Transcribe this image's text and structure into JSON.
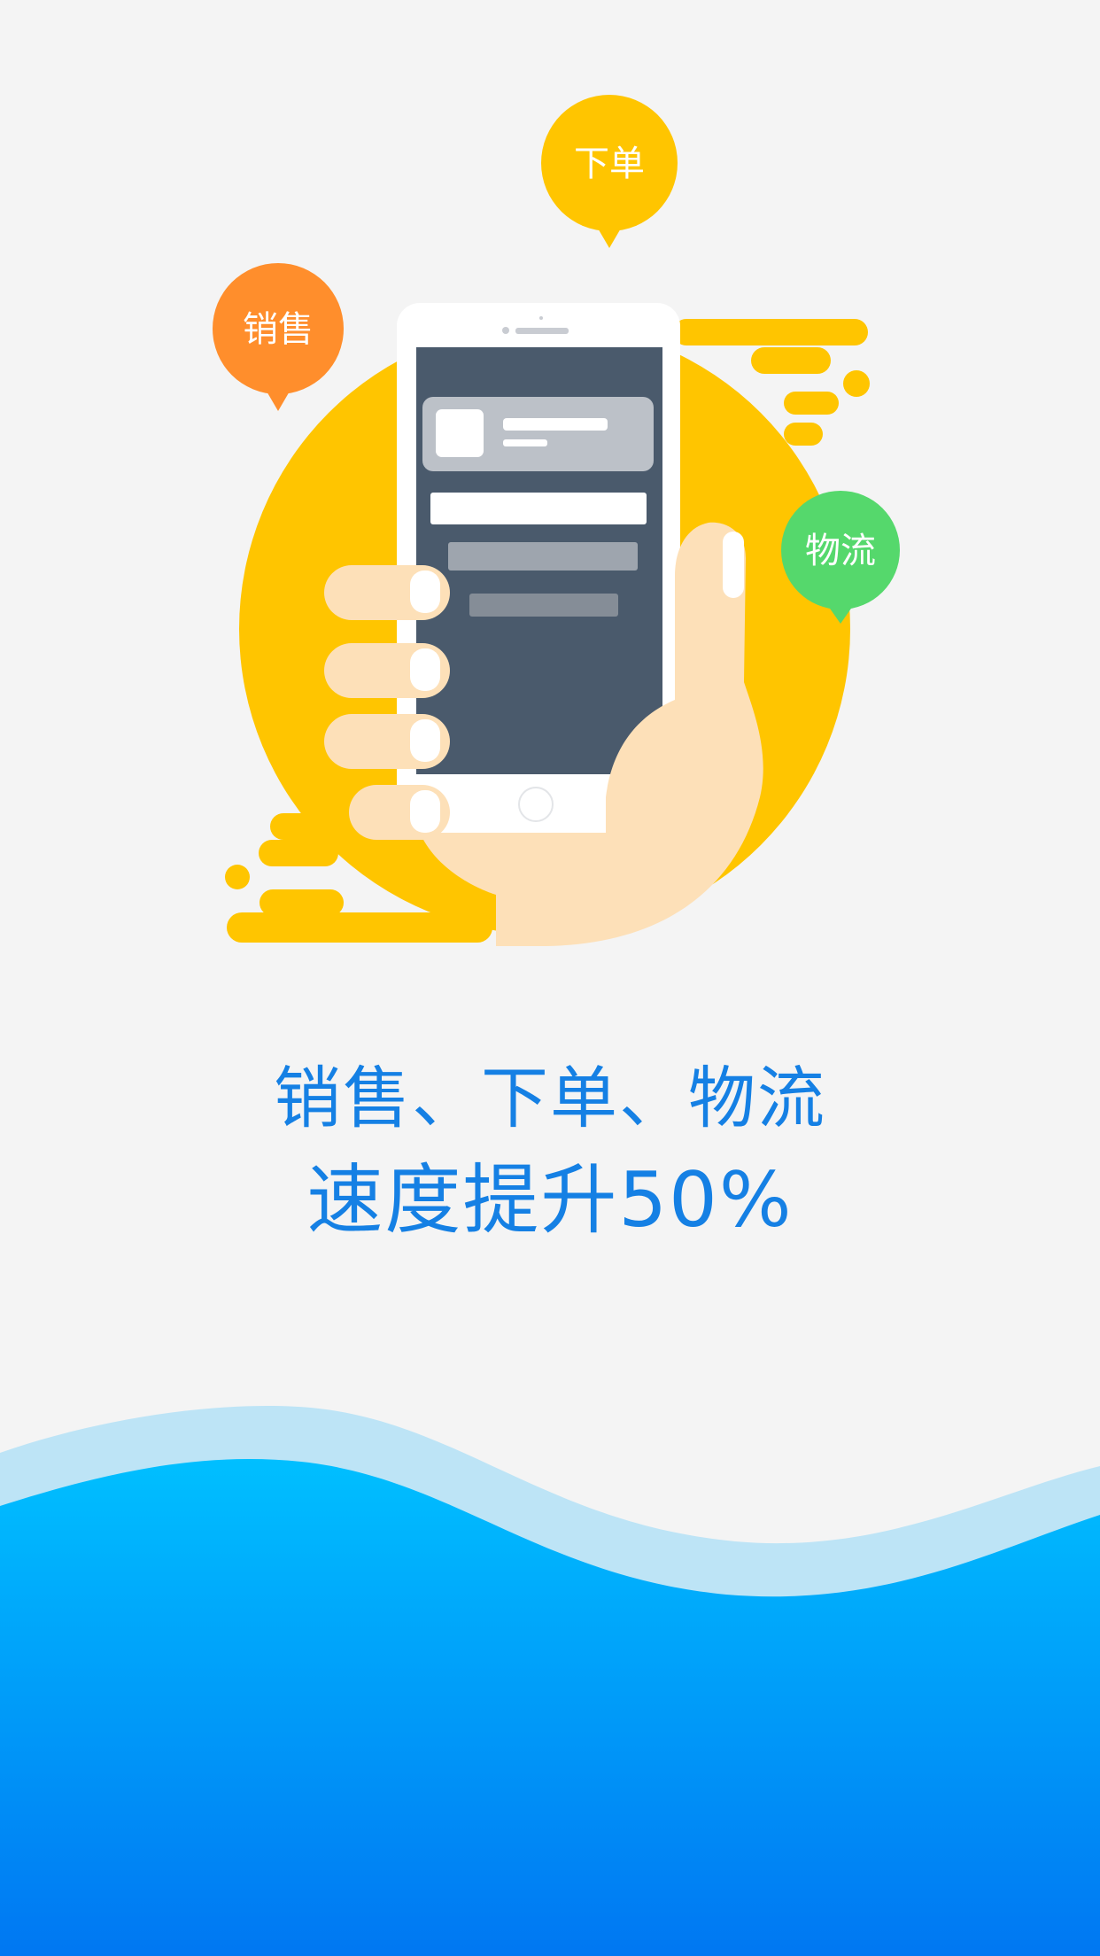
{
  "bubbles": {
    "sales": "销售",
    "order": "下单",
    "logistics": "物流"
  },
  "headline": {
    "line1": "销售、下单、物流",
    "line2": "速度提升50%"
  },
  "colors": {
    "background": "#f4f4f4",
    "accent_yellow": "#ffc500",
    "bubble_sales": "#ff8e2c",
    "bubble_order": "#ffc500",
    "bubble_logistics": "#55d86c",
    "headline_blue": "#1580e4",
    "wave_light": "#bde4f6",
    "wave_top": "#00bfff",
    "wave_bottom": "#0077f2"
  },
  "icons": [
    "hand-holding-phone-illustration"
  ]
}
